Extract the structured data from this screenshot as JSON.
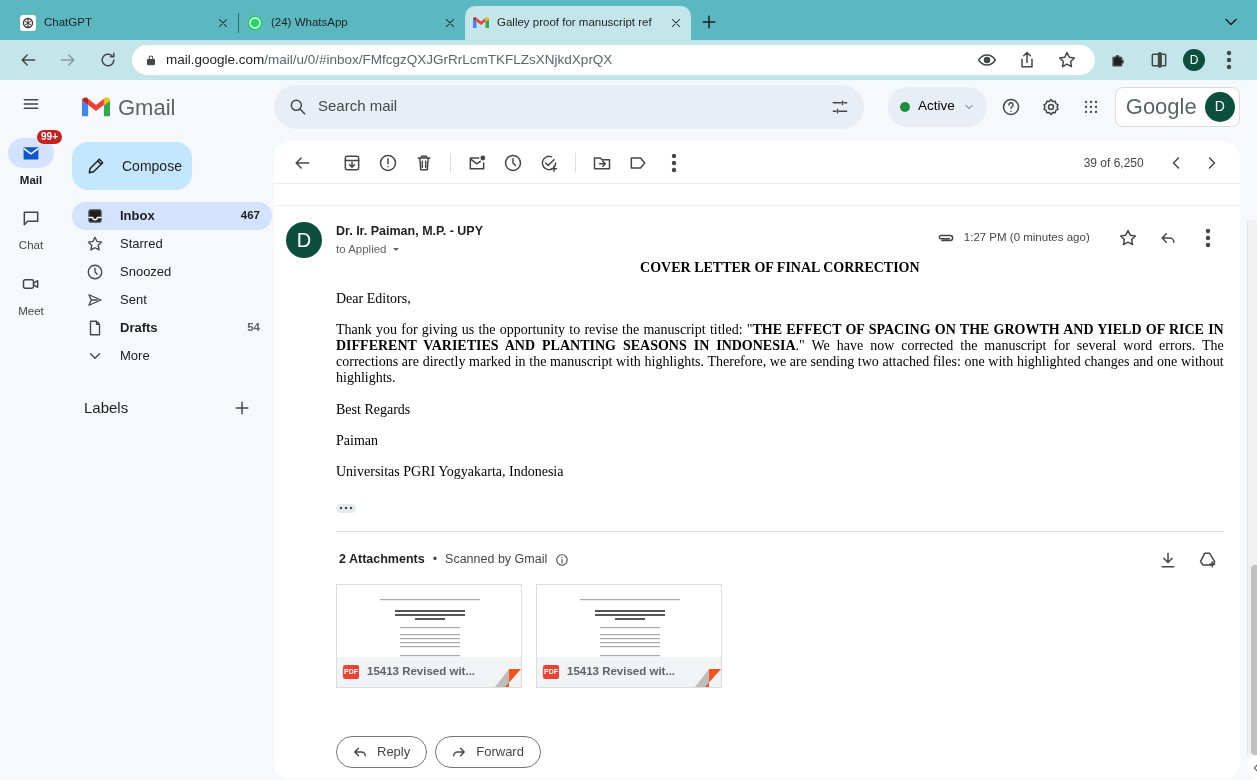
{
  "browser": {
    "tabs": [
      {
        "title": "ChatGPT",
        "kind": "chatgpt",
        "selected": false
      },
      {
        "title": "(24) WhatsApp",
        "kind": "whatsapp",
        "selected": false
      },
      {
        "title": "Galley proof for manuscript ref",
        "kind": "gmail",
        "selected": true
      }
    ],
    "url_host": "mail.google.com",
    "url_path": "/mail/u/0/#inbox/FMfcgzQXJGrRrLcmTKFLZsXNjkdXprQX",
    "profile_initial": "D"
  },
  "rail": [
    {
      "label": "Mail",
      "kind": "mail",
      "selected": true,
      "badge": "99+"
    },
    {
      "label": "Chat",
      "kind": "chat",
      "selected": false
    },
    {
      "label": "Meet",
      "kind": "meet",
      "selected": false
    }
  ],
  "app_name": "Gmail",
  "compose": "Compose",
  "folders": [
    {
      "label": "Inbox",
      "kind": "inbox",
      "count": "467",
      "selected": true,
      "emphasized": true
    },
    {
      "label": "Starred",
      "kind": "star",
      "selected": false,
      "emphasized": false
    },
    {
      "label": "Snoozed",
      "kind": "clock",
      "selected": false,
      "emphasized": false
    },
    {
      "label": "Sent",
      "kind": "send",
      "selected": false,
      "emphasized": false
    },
    {
      "label": "Drafts",
      "kind": "file",
      "count": "54",
      "selected": false,
      "emphasized": true
    },
    {
      "label": "More",
      "kind": "more",
      "selected": false,
      "emphasized": false
    }
  ],
  "labels_heading": "Labels",
  "search": {
    "placeholder": "Search mail"
  },
  "status": {
    "label": "Active",
    "color": "#1e8e3e"
  },
  "account": {
    "brand": "Google",
    "initial": "D"
  },
  "pager": "39 of 6,250",
  "message": {
    "sender": "Dr. Ir. Paiman, M.P. - UPY",
    "recipient": "to Applied",
    "avatar_initial": "D",
    "time": "1:27 PM (0 minutes ago)",
    "starred": false,
    "heading": "COVER LETTER OF FINAL CORRECTION",
    "paragraphs": [
      "Dear Editors,",
      "Thank you for giving us the opportunity to revise the manuscript titled: \"**THE EFFECT OF SPACING ON THE GROWTH AND YIELD OF RICE IN DIFFERENT VARIETIES AND PLANTING SEASONS IN INDONESIA**.\" We have now corrected the manuscript for several word errors. The corrections are directly marked in the manuscript with highlights. Therefore, we are sending two attached files: one with highlighted changes and one without highlights.",
      "Best Regards",
      "Paiman",
      "Universitas PGRI Yogyakarta, Indonesia"
    ],
    "attachments_title": "2 Attachments",
    "separator": "•",
    "scanned": "Scanned by Gmail",
    "attachments": [
      {
        "name": "15413 Revised wit...",
        "type": "PDF"
      },
      {
        "name": "15413 Revised wit...",
        "type": "PDF"
      }
    ],
    "actions": [
      {
        "label": "Reply",
        "kind": "reply"
      },
      {
        "label": "Forward",
        "kind": "forward"
      }
    ]
  }
}
